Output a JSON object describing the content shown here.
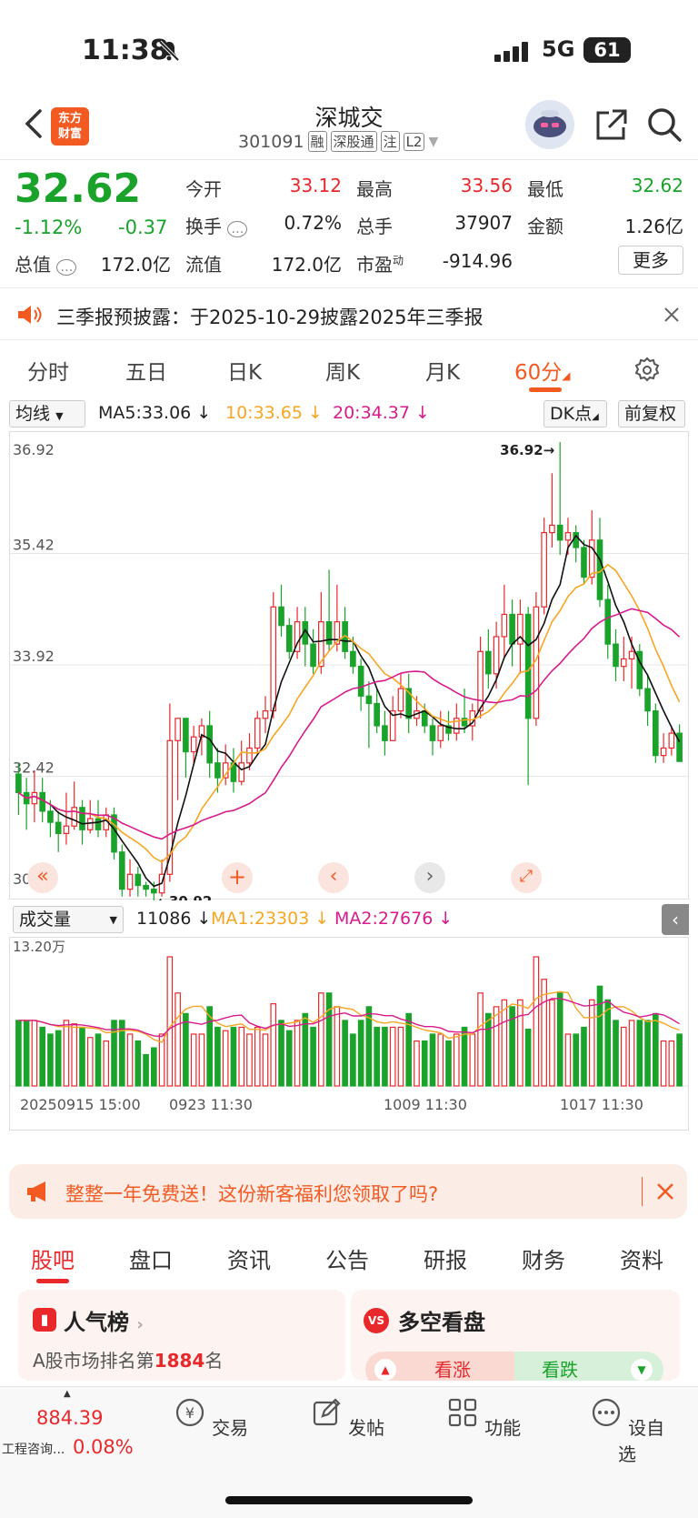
{
  "status_bar": {
    "time": "11:38",
    "network": "5G",
    "battery": "61"
  },
  "header": {
    "stock_name": "深城交",
    "stock_code": "301091",
    "tags": [
      "融",
      "深股通",
      "注",
      "L2"
    ],
    "logo_text": "东方\n财富"
  },
  "quote": {
    "price": "32.62",
    "pct_change": "-1.12%",
    "change": "-0.37",
    "open_label": "今开",
    "open": "33.12",
    "high_label": "最高",
    "high": "33.56",
    "low_label": "最低",
    "low": "32.62",
    "turnover_label": "换手",
    "turnover": "0.72%",
    "volume_label": "总手",
    "volume": "37907",
    "amount_label": "金额",
    "amount": "1.26亿",
    "mktcap_label": "总值",
    "mktcap": "172.0亿",
    "float_label": "流值",
    "float": "172.0亿",
    "pe_label": "市盈",
    "pe_sup": "动",
    "pe": "-914.96",
    "more_label": "更多"
  },
  "notice": {
    "text": "三季报预披露：于2025-10-29披露2025年三季报"
  },
  "period_tabs": [
    "分时",
    "五日",
    "日K",
    "周K",
    "月K",
    "60分"
  ],
  "period_active": "60分",
  "ma_bar": {
    "selector": "均线",
    "ma5": "MA5:33.06",
    "ma10": "10:33.65",
    "ma20": "20:34.37",
    "dk": "DK点",
    "fuquan": "前复权"
  },
  "colors": {
    "up": "#e8282b",
    "down": "#1aa32a",
    "ma5": "#111111",
    "ma10": "#f6a623",
    "ma20": "#d81b8c",
    "accent": "#f25a22"
  },
  "chart_data": {
    "type": "candlestick",
    "y_ticks": [
      "36.92",
      "35.42",
      "33.92",
      "32.42",
      "30.92"
    ],
    "ylim": [
      30.92,
      36.92
    ],
    "max_label": "36.92",
    "min_label": "30.92",
    "x_labels": [
      "20250915 15:00",
      "0923 11:30",
      "1009 11:30",
      "1017 11:30"
    ],
    "candles": [
      [
        32.45,
        32.2,
        32.6,
        31.9
      ],
      [
        32.2,
        32.05,
        32.4,
        31.7
      ],
      [
        32.05,
        32.2,
        32.5,
        31.8
      ],
      [
        32.2,
        31.95,
        32.4,
        31.8
      ],
      [
        31.95,
        31.8,
        32.1,
        31.6
      ],
      [
        31.8,
        31.65,
        31.95,
        31.4
      ],
      [
        31.65,
        31.75,
        32.2,
        31.5
      ],
      [
        31.75,
        32.0,
        32.35,
        31.7
      ],
      [
        32.0,
        31.7,
        32.1,
        31.5
      ],
      [
        31.7,
        31.85,
        32.1,
        31.65
      ],
      [
        31.85,
        31.7,
        32.1,
        31.6
      ],
      [
        31.7,
        31.9,
        32.0,
        31.6
      ],
      [
        31.9,
        31.4,
        32.0,
        31.3
      ],
      [
        31.4,
        30.9,
        31.5,
        30.8
      ],
      [
        30.9,
        31.1,
        31.3,
        30.8
      ],
      [
        31.1,
        30.95,
        31.2,
        30.8
      ],
      [
        30.95,
        30.9,
        31.0,
        30.8
      ],
      [
        30.9,
        30.85,
        31.0,
        30.7
      ],
      [
        30.85,
        31.1,
        31.3,
        30.8
      ],
      [
        31.1,
        32.9,
        33.4,
        31.0
      ],
      [
        32.9,
        33.2,
        33.2,
        32.1
      ],
      [
        33.2,
        32.75,
        33.2,
        32.4
      ],
      [
        32.75,
        32.95,
        33.1,
        32.6
      ],
      [
        32.95,
        33.1,
        33.2,
        32.7
      ],
      [
        33.1,
        32.6,
        33.3,
        32.4
      ],
      [
        32.6,
        32.4,
        32.8,
        32.2
      ],
      [
        32.4,
        32.6,
        32.85,
        32.3
      ],
      [
        32.6,
        32.35,
        32.8,
        32.2
      ],
      [
        32.35,
        32.6,
        32.9,
        32.3
      ],
      [
        32.6,
        32.8,
        33.0,
        32.5
      ],
      [
        32.8,
        33.2,
        33.3,
        32.7
      ],
      [
        33.2,
        33.3,
        33.5,
        33.0
      ],
      [
        33.3,
        34.7,
        34.9,
        33.2
      ],
      [
        34.7,
        34.45,
        35.0,
        34.3
      ],
      [
        34.45,
        34.1,
        34.55,
        34.0
      ],
      [
        34.1,
        34.5,
        34.7,
        34.0
      ],
      [
        34.5,
        34.2,
        34.7,
        33.9
      ],
      [
        34.2,
        33.9,
        34.4,
        33.8
      ],
      [
        33.9,
        34.5,
        34.9,
        33.8
      ],
      [
        34.5,
        34.2,
        35.2,
        34.1
      ],
      [
        34.2,
        34.5,
        35.0,
        34.1
      ],
      [
        34.5,
        34.1,
        34.7,
        34.0
      ],
      [
        34.1,
        33.9,
        34.3,
        33.8
      ],
      [
        33.9,
        33.5,
        34.0,
        33.3
      ],
      [
        33.5,
        33.4,
        33.7,
        32.8
      ],
      [
        33.4,
        33.1,
        33.6,
        33.0
      ],
      [
        33.1,
        32.9,
        33.3,
        32.7
      ],
      [
        32.9,
        33.3,
        33.5,
        32.9
      ],
      [
        33.3,
        33.6,
        33.8,
        33.2
      ],
      [
        33.6,
        33.2,
        33.8,
        33.0
      ],
      [
        33.2,
        33.3,
        33.5,
        33.1
      ],
      [
        33.3,
        33.1,
        33.4,
        33.0
      ],
      [
        33.1,
        32.9,
        33.2,
        32.7
      ],
      [
        32.9,
        33.1,
        33.3,
        32.8
      ],
      [
        33.1,
        33.0,
        33.3,
        32.9
      ],
      [
        33.0,
        33.2,
        33.4,
        32.9
      ],
      [
        33.2,
        33.1,
        33.6,
        33.0
      ],
      [
        33.1,
        33.3,
        33.4,
        32.9
      ],
      [
        33.3,
        34.1,
        34.3,
        33.2
      ],
      [
        34.1,
        33.8,
        34.4,
        33.6
      ],
      [
        33.8,
        34.3,
        34.5,
        33.6
      ],
      [
        34.3,
        34.6,
        35.0,
        34.0
      ],
      [
        34.6,
        34.2,
        34.8,
        33.9
      ],
      [
        34.2,
        34.6,
        34.8,
        33.8
      ],
      [
        34.6,
        33.2,
        34.7,
        32.3
      ],
      [
        33.2,
        34.7,
        34.9,
        33.1
      ],
      [
        34.7,
        35.7,
        35.9,
        34.6
      ],
      [
        35.7,
        35.8,
        36.5,
        35.5
      ],
      [
        35.8,
        35.6,
        36.92,
        35.4
      ],
      [
        35.6,
        35.7,
        35.9,
        35.4
      ],
      [
        35.7,
        35.5,
        35.8,
        35.3
      ],
      [
        35.5,
        35.1,
        35.6,
        35.0
      ],
      [
        35.1,
        35.6,
        36.0,
        35.0
      ],
      [
        35.6,
        34.8,
        35.9,
        34.7
      ],
      [
        34.8,
        34.2,
        35.0,
        34.0
      ],
      [
        34.2,
        33.9,
        34.4,
        33.7
      ],
      [
        33.9,
        34.0,
        34.3,
        33.7
      ],
      [
        34.0,
        34.1,
        34.3,
        33.6
      ],
      [
        34.1,
        33.6,
        34.2,
        33.5
      ],
      [
        33.6,
        33.3,
        33.8,
        33.1
      ],
      [
        33.3,
        32.7,
        33.4,
        32.6
      ],
      [
        32.7,
        32.8,
        33.0,
        32.6
      ],
      [
        32.8,
        33.0,
        33.1,
        32.7
      ],
      [
        33.0,
        32.62,
        33.12,
        32.62
      ]
    ],
    "volume_label": "成交量",
    "volume_value": "11086",
    "vol_ma1": "MA1:23303",
    "vol_ma2": "MA2:27676",
    "volume_max_label": "13.20万",
    "volume_max": 132000
  },
  "promo": {
    "text": "整整一年免费送！这份新客福利您领取了吗?"
  },
  "bottom_tabs": [
    "股吧",
    "盘口",
    "资讯",
    "公告",
    "研报",
    "财务",
    "资料"
  ],
  "bottom_tabs_active": "股吧",
  "cards": {
    "left_title": "人气榜",
    "left_line": "A股市场排名第",
    "left_rank": "1884",
    "left_suffix": "名",
    "right_title": "多空看盘",
    "right_up": "看涨",
    "right_down": "看跌"
  },
  "index_ticker": {
    "value": "884.39",
    "name": "工程咨询...",
    "pct": "0.08%"
  },
  "bottom_nav": [
    "交易",
    "发帖",
    "功能",
    "设自选"
  ]
}
